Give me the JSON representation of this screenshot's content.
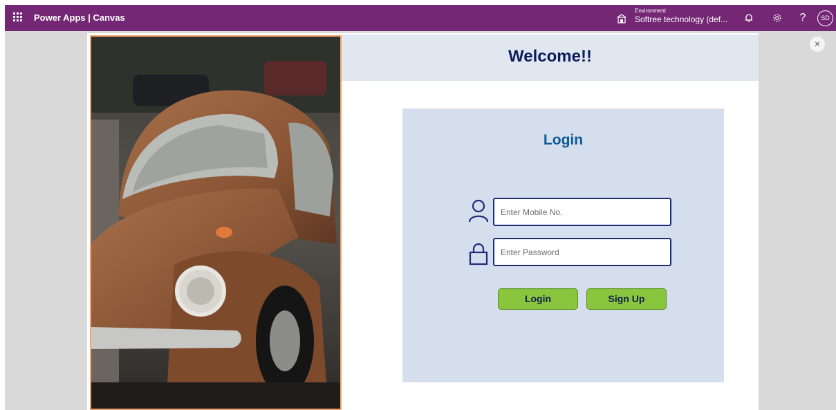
{
  "header": {
    "app_title": "Power Apps | Canvas",
    "environment_label": "Environment",
    "environment_value": "Softree technology (def...",
    "help_glyph": "?",
    "avatar_initials": "SD",
    "icons": [
      "waffle-icon",
      "environment-icon",
      "bell-icon",
      "gear-icon",
      "help-icon"
    ],
    "bar_color": "#742774"
  },
  "overlay": {
    "close_glyph": "×"
  },
  "screen": {
    "welcome_title": "Welcome!!",
    "photo_subject": "car-photo",
    "login": {
      "title": "Login",
      "mobile_placeholder": "Enter Mobile No.",
      "password_placeholder": "Enter Password",
      "login_button": "Login",
      "signup_button": "Sign Up"
    },
    "colors": {
      "welcome_band": "#e1e7f1",
      "panel": "#d5deed",
      "button": "#8ac53e",
      "title": "#0b1d59"
    }
  }
}
